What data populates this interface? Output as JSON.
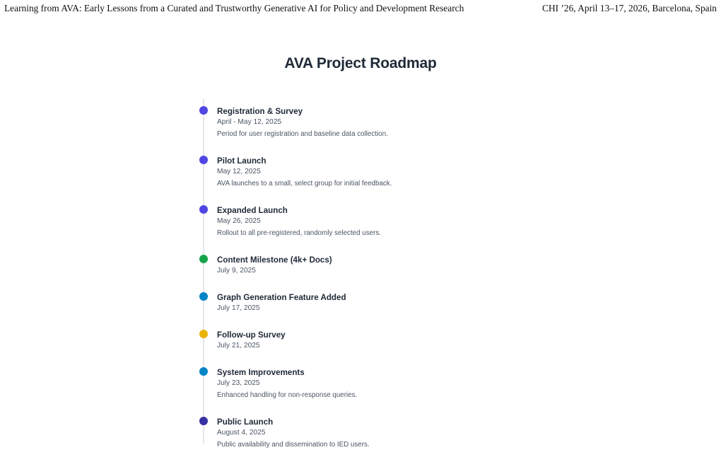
{
  "header": {
    "left": "Learning from AVA: Early Lessons from a Curated and Trustworthy Generative AI for Policy and Development Research",
    "right": "CHI ’26, April 13–17, 2026, Barcelona, Spain"
  },
  "figure": {
    "title": "AVA Project Roadmap"
  },
  "colors": {
    "purple": "#4f46e5",
    "green": "#16a34a",
    "blue": "#0284c7",
    "yellow": "#eab308",
    "indigo": "#3730a3",
    "line": "#e5e7eb"
  },
  "events": [
    {
      "title": "Registration & Survey",
      "date": "April - May 12, 2025",
      "description": "Period for user registration and baseline data collection.",
      "dot_color": "#4f46e5"
    },
    {
      "title": "Pilot Launch",
      "date": "May 12, 2025",
      "description": "AVA launches to a small, select group for initial feedback.",
      "dot_color": "#4f46e5"
    },
    {
      "title": "Expanded Launch",
      "date": "May 26, 2025",
      "description": "Rollout to all pre-registered, randomly selected users.",
      "dot_color": "#4f46e5"
    },
    {
      "title": "Content Milestone (4k+ Docs)",
      "date": "July 9, 2025",
      "description": "",
      "dot_color": "#16a34a"
    },
    {
      "title": "Graph Generation Feature Added",
      "date": "July 17, 2025",
      "description": "",
      "dot_color": "#0284c7"
    },
    {
      "title": "Follow-up Survey",
      "date": "July 21, 2025",
      "description": "",
      "dot_color": "#eab308"
    },
    {
      "title": "System Improvements",
      "date": "July 23, 2025",
      "description": "Enhanced handling for non-response queries.",
      "dot_color": "#0284c7"
    },
    {
      "title": "Public Launch",
      "date": "August 4, 2025",
      "description": "Public availability and dissemination to IED users.",
      "dot_color": "#3730a3"
    }
  ]
}
